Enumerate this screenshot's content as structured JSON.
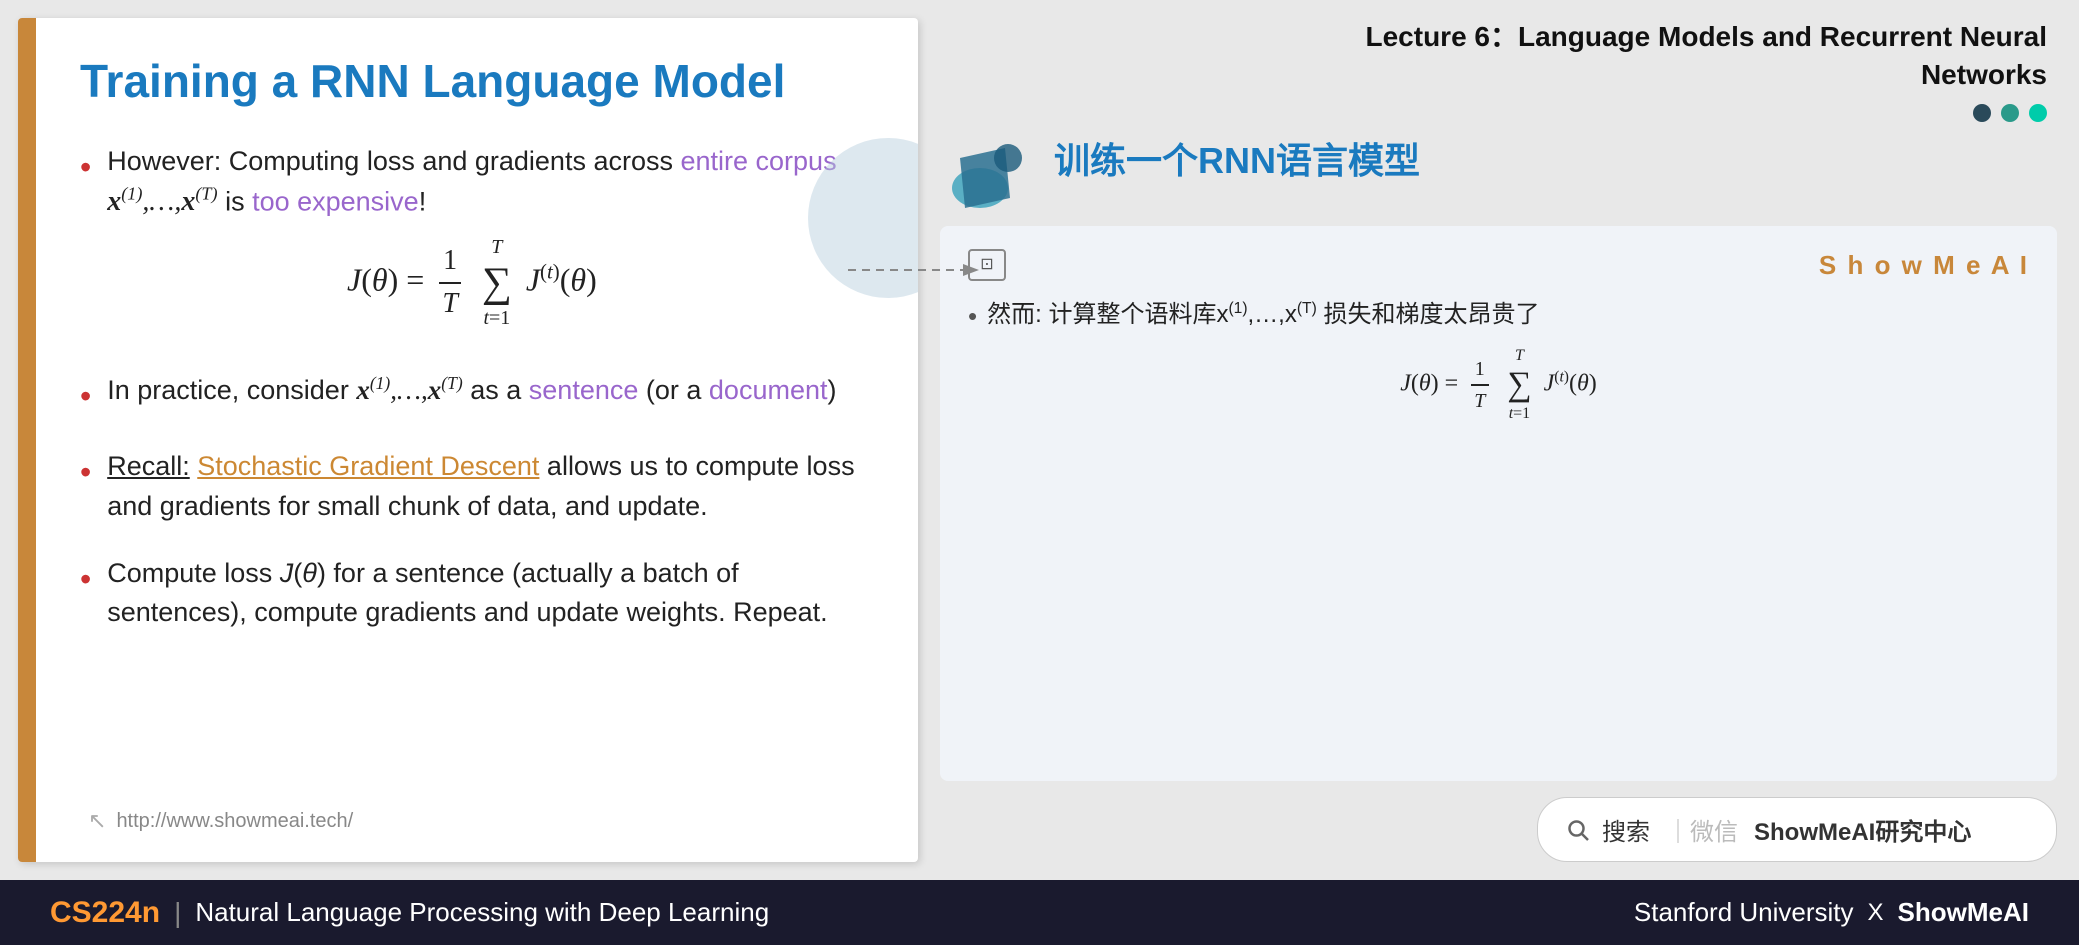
{
  "slide": {
    "title": "Training a RNN Language Model",
    "bullets": [
      {
        "id": "bullet1",
        "prefix": "However: Computing loss and gradients across ",
        "highlight": "entire corpus",
        "suffix_italic": "x",
        "suffix": " is ",
        "expensive": "too expensive",
        "end": "!"
      },
      {
        "id": "bullet2",
        "text": "In practice, consider "
      },
      {
        "id": "bullet3",
        "recall_label": "Recall:",
        "sgd": "Stochastic Gradient Descent",
        "suffix": " allows us to compute loss and gradients for small chunk of data, and update."
      },
      {
        "id": "bullet4",
        "text": "Compute loss J(θ) for a sentence (actually a batch of sentences), compute gradients and update weights. Repeat."
      }
    ],
    "footer_url": "http://www.showmeai.tech/"
  },
  "right_panel": {
    "lecture_line1": "Lecture 6：Language Models and Recurrent Neural",
    "lecture_line2": "Networks",
    "chinese_title": "训练一个RNN语言模型",
    "translation_box": {
      "showmeai_brand": "S h o w M e A I",
      "cn_text_prefix": "然而: 计算整个语料库x",
      "cn_text_suffix": "损失和梯度太昂贵了"
    },
    "search_bar": {
      "icon": "search",
      "divider": "|",
      "text_prefix": "搜索",
      "text_divider": "｜微信 ",
      "text_bold": "ShowMeAI研究中心"
    }
  },
  "bottom_bar": {
    "cs224n": "CS224n",
    "pipe": "|",
    "subtitle": "Natural Language Processing with Deep Learning",
    "stanford": "Stanford University",
    "x": "X",
    "showmeai": "ShowMeAI"
  }
}
